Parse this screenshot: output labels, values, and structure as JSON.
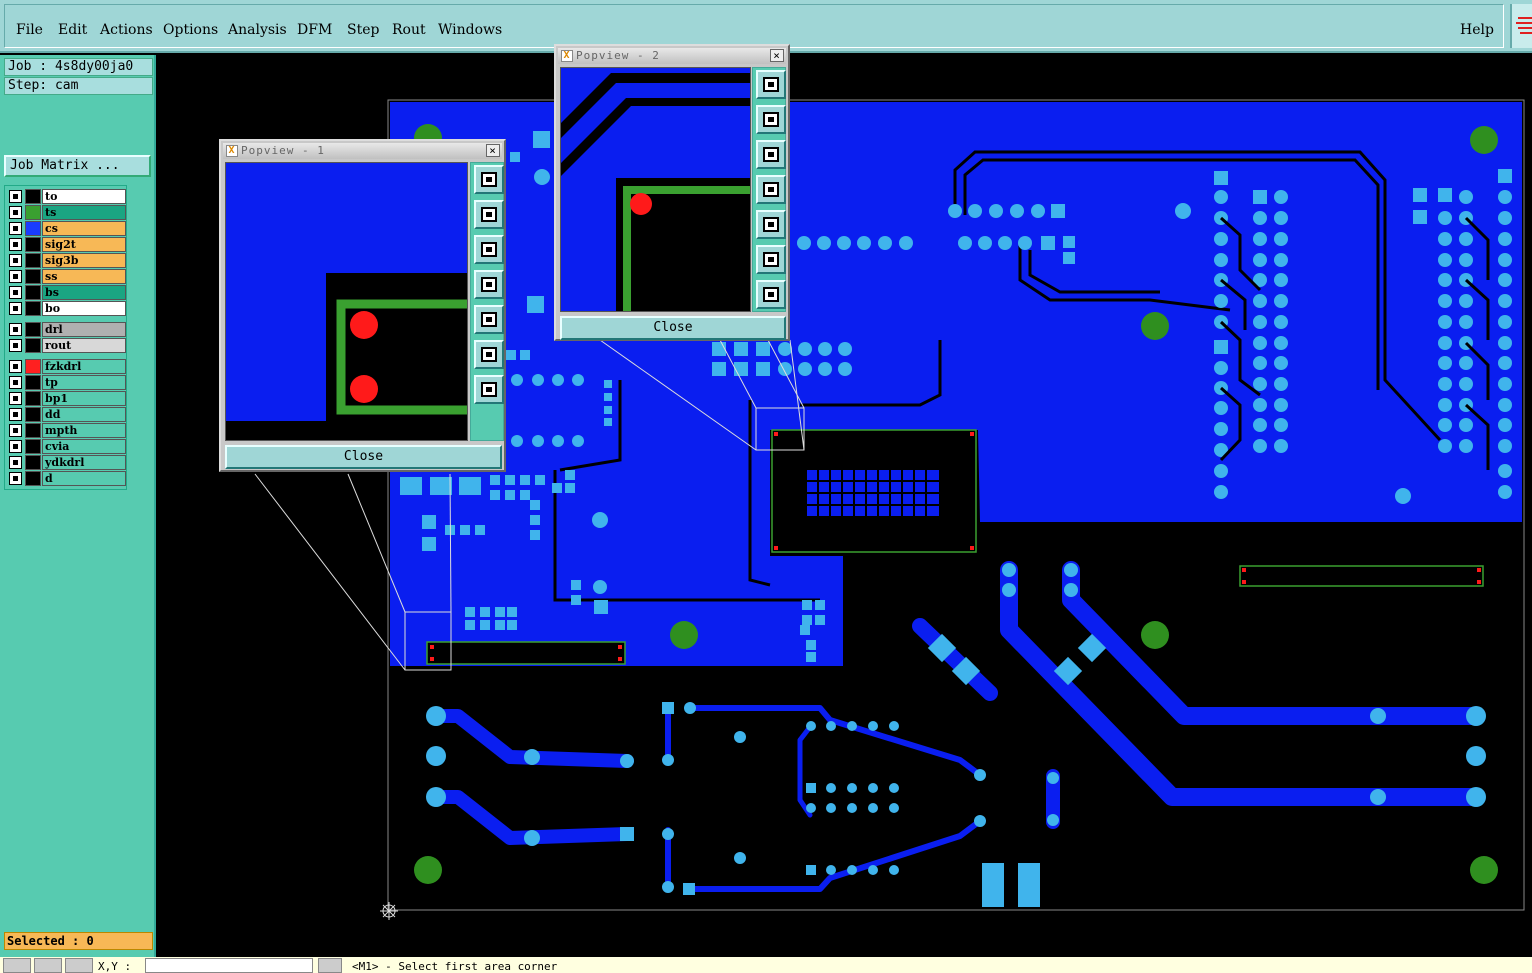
{
  "menu": {
    "items": [
      "File",
      "Edit",
      "Actions",
      "Options",
      "Analysis",
      "DFM",
      "Step",
      "Rout",
      "Windows"
    ],
    "help": "Help"
  },
  "info": {
    "job": "Job : 4s8dy00ja0",
    "step": "Step: cam",
    "job_matrix": "Job Matrix ..."
  },
  "layers": [
    {
      "name": "to",
      "swatch": "#000000",
      "bg": "#ffffff"
    },
    {
      "name": "ts",
      "swatch": "#3aa030",
      "bg": "#1aa582"
    },
    {
      "name": "cs",
      "swatch": "#1a3cff",
      "bg": "#f7b856"
    },
    {
      "name": "sig2t",
      "swatch": "#000000",
      "bg": "#f7b856"
    },
    {
      "name": "sig3b",
      "swatch": "#000000",
      "bg": "#f7b856"
    },
    {
      "name": "ss",
      "swatch": "#000000",
      "bg": "#f7b856"
    },
    {
      "name": "bs",
      "swatch": "#000000",
      "bg": "#1aa582"
    },
    {
      "name": "bo",
      "swatch": "#000000",
      "bg": "#ffffff"
    },
    {
      "name": "drl",
      "swatch": "#000000",
      "bg": "#b0b0b0"
    },
    {
      "name": "rout",
      "swatch": "#000000",
      "bg": "#d8d8d8"
    },
    {
      "name": "fzkdrl",
      "swatch": "#ff2020",
      "bg": "#57cbb0"
    },
    {
      "name": "tp",
      "swatch": "#000000",
      "bg": "#57cbb0"
    },
    {
      "name": "bp1",
      "swatch": "#000000",
      "bg": "#57cbb0"
    },
    {
      "name": "dd",
      "swatch": "#000000",
      "bg": "#57cbb0"
    },
    {
      "name": "mpth",
      "swatch": "#000000",
      "bg": "#57cbb0"
    },
    {
      "name": "cvia",
      "swatch": "#000000",
      "bg": "#57cbb0"
    },
    {
      "name": "ydkdrl",
      "swatch": "#000000",
      "bg": "#57cbb0"
    },
    {
      "name": "d",
      "swatch": "#000000",
      "bg": "#57cbb0"
    }
  ],
  "selected": "Selected : 0",
  "status": {
    "xy_label": "X,Y :",
    "prompt": "<M1> - Select first area corner"
  },
  "popview1": {
    "title": "Popview - 1",
    "close": "Close"
  },
  "popview2": {
    "title": "Popview - 2",
    "close": "Close"
  },
  "colors": {
    "board_blue": "#0a1ef0",
    "pad_cyan": "#40b4ec",
    "fiducial_green": "#2f8f1f",
    "outline_green": "#3aa030",
    "drill_red": "#ff1a1a"
  }
}
